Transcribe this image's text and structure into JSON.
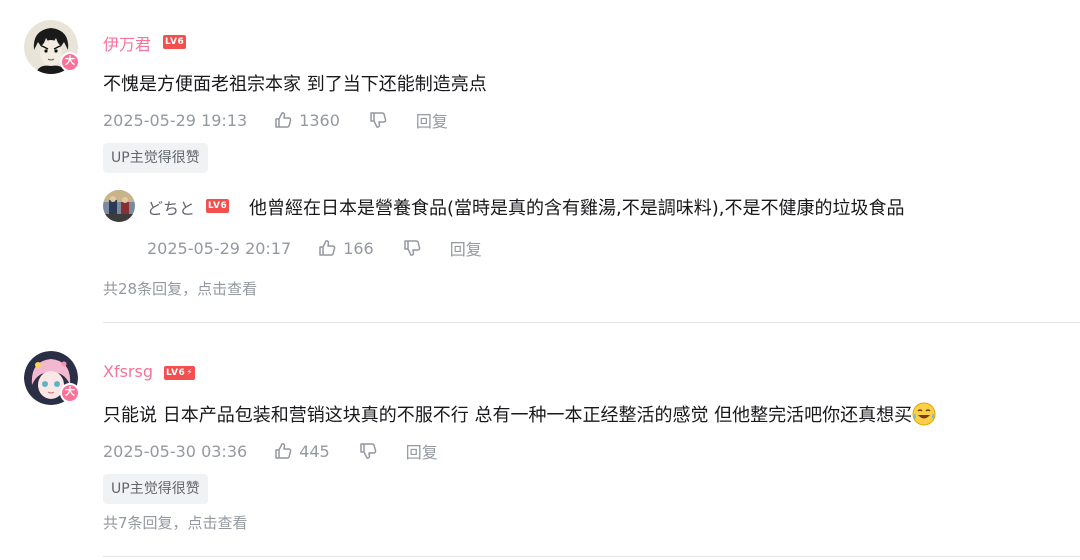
{
  "comments": [
    {
      "username": "伊万君",
      "level": "LV6",
      "vip_badge": "大",
      "content": "不愧是方便面老祖宗本家 到了当下还能制造亮点",
      "time": "2025-05-29 19:13",
      "likes": "1360",
      "reply_label": "回复",
      "badge": "UP主觉得很赞",
      "sub_reply": {
        "username": "どちと",
        "level": "LV6",
        "content": "他曾經在日本是營養食品(當時是真的含有雞湯,不是調味料),不是不健康的垃圾食品",
        "time": "2025-05-29 20:17",
        "likes": "166",
        "reply_label": "回复"
      },
      "more_replies": "共28条回复，点击查看"
    },
    {
      "username": "Xfsrsg",
      "level": "LV6",
      "vip_badge": "大",
      "content": "只能说 日本产品包装和营销这块真的不服不行 总有一种一本正经整活的感觉 但他整完活吧你还真想买",
      "time": "2025-05-30 03:36",
      "likes": "445",
      "reply_label": "回复",
      "badge": "UP主觉得很赞",
      "more_replies": "共7条回复，点击查看"
    }
  ],
  "icons": {
    "like": "thumb-up-icon",
    "dislike": "thumb-down-icon",
    "emoji": "laughing-tears-emoji"
  },
  "colors": {
    "username_pink": "#fb7299",
    "level_red": "#f44f4f",
    "meta_gray": "#9499a0",
    "badge_bg": "#f1f2f3"
  }
}
